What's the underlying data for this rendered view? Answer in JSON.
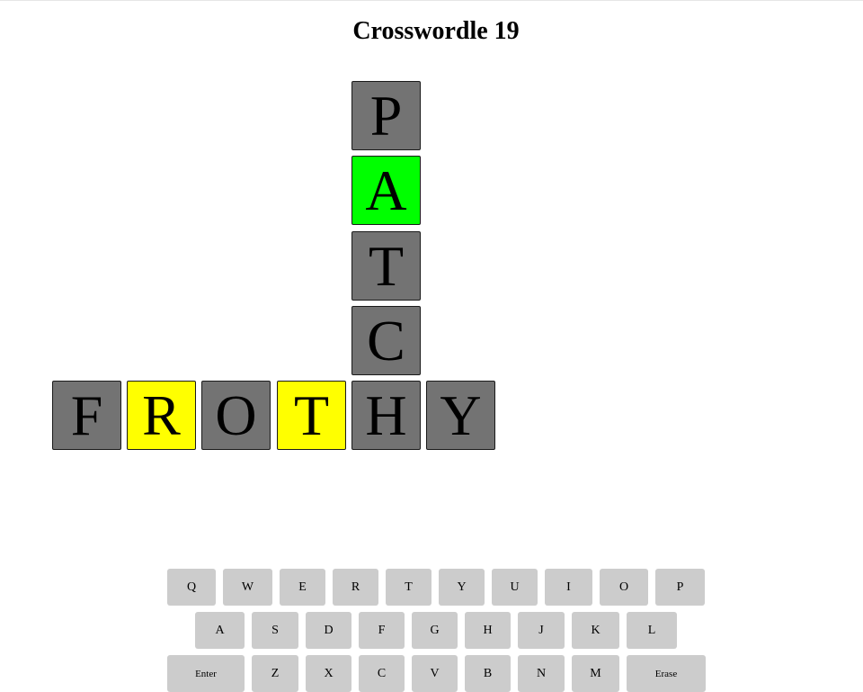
{
  "title": "Crosswordle 19",
  "colors": {
    "gray": "#737373",
    "yellow": "#ffff00",
    "green": "#00ff00"
  },
  "board": {
    "vertical": {
      "word": "PATCHY",
      "tiles": [
        {
          "letter": "P",
          "state": "gray"
        },
        {
          "letter": "A",
          "state": "green"
        },
        {
          "letter": "T",
          "state": "gray"
        },
        {
          "letter": "C",
          "state": "gray"
        }
      ]
    },
    "horizontal": {
      "word": "FROTHY",
      "tiles": [
        {
          "letter": "F",
          "state": "gray"
        },
        {
          "letter": "R",
          "state": "yellow"
        },
        {
          "letter": "O",
          "state": "gray"
        },
        {
          "letter": "T",
          "state": "yellow"
        },
        {
          "letter": "H",
          "state": "gray"
        },
        {
          "letter": "Y",
          "state": "gray"
        }
      ]
    }
  },
  "keyboard": {
    "rows": [
      [
        "Q",
        "W",
        "E",
        "R",
        "T",
        "Y",
        "U",
        "I",
        "O",
        "P"
      ],
      [
        "A",
        "S",
        "D",
        "F",
        "G",
        "H",
        "J",
        "K",
        "L"
      ],
      [
        "Enter",
        "Z",
        "X",
        "C",
        "V",
        "B",
        "N",
        "M",
        "Erase"
      ]
    ]
  }
}
